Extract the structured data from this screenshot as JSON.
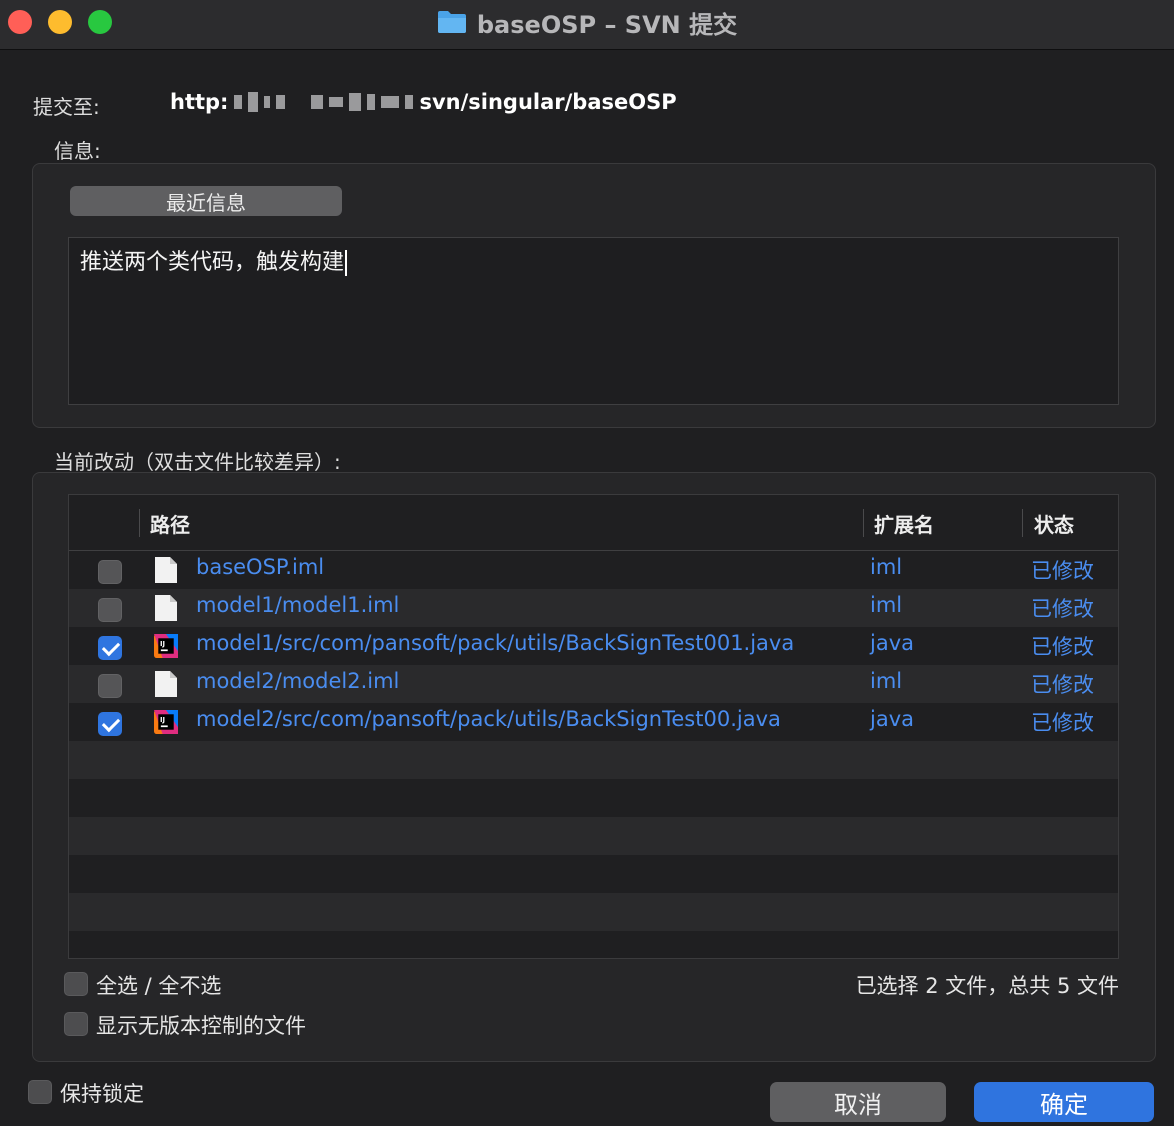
{
  "window": {
    "title": "baseOSP – SVN 提交",
    "title_icon": "folder-icon"
  },
  "commit": {
    "to_label": "提交至:",
    "url_prefix": "http:",
    "url_suffix": "svn/singular/baseOSP"
  },
  "message": {
    "label": "信息:",
    "recent_button": "最近信息",
    "text": "推送两个类代码，触发构建"
  },
  "changes": {
    "label": "当前改动（双击文件比较差异）:",
    "columns": {
      "path": "路径",
      "ext": "扩展名",
      "status": "状态"
    },
    "rows": [
      {
        "checked": false,
        "icon": "file-icon",
        "path": "baseOSP.iml",
        "ext": "iml",
        "status": "已修改"
      },
      {
        "checked": false,
        "icon": "file-icon",
        "path": "model1/model1.iml",
        "ext": "iml",
        "status": "已修改"
      },
      {
        "checked": true,
        "icon": "intellij-icon",
        "path": "model1/src/com/pansoft/pack/utils/BackSignTest001.java",
        "ext": "java",
        "status": "已修改"
      },
      {
        "checked": false,
        "icon": "file-icon",
        "path": "model2/model2.iml",
        "ext": "iml",
        "status": "已修改"
      },
      {
        "checked": true,
        "icon": "intellij-icon",
        "path": "model2/src/com/pansoft/pack/utils/BackSignTest00.java",
        "ext": "java",
        "status": "已修改"
      }
    ],
    "select_all": "全选 / 全不选",
    "show_unversioned": "显示无版本控制的文件",
    "summary": "已选择 2 文件，总共 5 文件"
  },
  "footer": {
    "keep_locks": "保持锁定",
    "cancel": "取消",
    "ok": "确定"
  },
  "colors": {
    "accent": "#2f74df",
    "link": "#4a8df0",
    "background": "#1f1f21"
  }
}
